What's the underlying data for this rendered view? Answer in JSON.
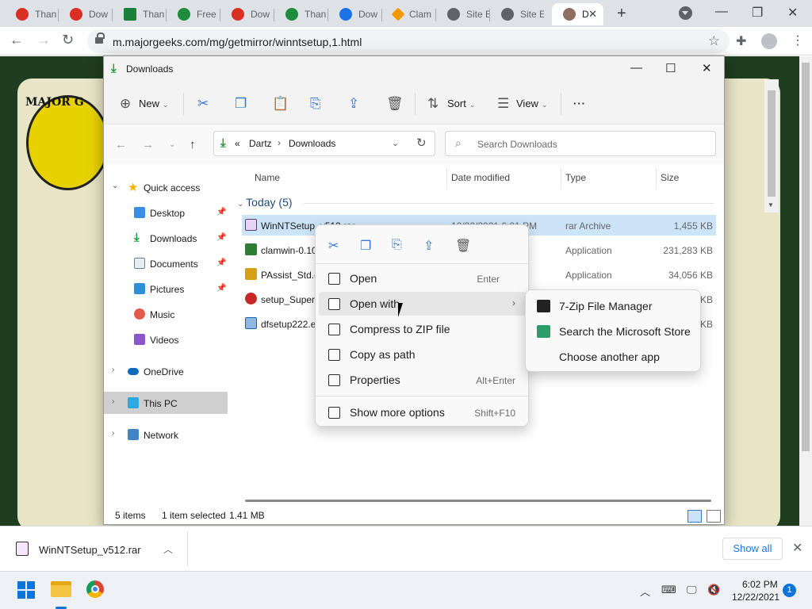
{
  "browser": {
    "tabs": [
      {
        "title": "Than",
        "color": "#d93025"
      },
      {
        "title": "Dow",
        "color": "#d93025"
      },
      {
        "title": "Than",
        "color": "#188038"
      },
      {
        "title": "Free",
        "color": "#1e8e3e"
      },
      {
        "title": "Dow",
        "color": "#d93025"
      },
      {
        "title": "Than",
        "color": "#1e8e3e"
      },
      {
        "title": "Dow",
        "color": "#1a73e8"
      },
      {
        "title": "Clam",
        "color": "#f29900"
      },
      {
        "title": "Site E",
        "color": "#5f6368"
      },
      {
        "title": "Site E",
        "color": "#5f6368"
      },
      {
        "title": "D",
        "color": "#8d6e63"
      }
    ],
    "new_tab": "+",
    "url": "m.majorgeeks.com/mg/getmirror/winntsetup,1.html"
  },
  "website": {
    "logo_text": "MAJOR G"
  },
  "explorer": {
    "title": "Downloads",
    "ribbon": {
      "new_label": "New",
      "sort_label": "Sort",
      "view_label": "View",
      "more": "···"
    },
    "breadcrumb": {
      "overflow": "«",
      "parent": "Dartz",
      "current": "Downloads"
    },
    "search_placeholder": "Search Downloads",
    "nav": {
      "quick_access": "Quick access",
      "desktop": "Desktop",
      "downloads": "Downloads",
      "documents": "Documents",
      "pictures": "Pictures",
      "music": "Music",
      "videos": "Videos",
      "onedrive": "OneDrive",
      "this_pc": "This PC",
      "network": "Network"
    },
    "columns": {
      "name": "Name",
      "date": "Date modified",
      "type": "Type",
      "size": "Size"
    },
    "group": "Today (5)",
    "files": [
      {
        "name": "WinNTSetup_v512.rar",
        "date": "12/22/2021 6:01 PM",
        "type": "rar Archive",
        "size": "1,455 KB",
        "color": "#9b59b6"
      },
      {
        "name": "clamwin-0.10",
        "date": "1",
        "type": "Application",
        "size": "231,283 KB",
        "color": "#2e7d32"
      },
      {
        "name": "PAssist_Std.ex",
        "date": "1",
        "type": "Application",
        "size": "34,056 KB",
        "color": "#d4a017"
      },
      {
        "name": "setup_SuperF",
        "date": "",
        "type": "",
        "size": "KB",
        "color": "#c62828"
      },
      {
        "name": "dfsetup222.ex",
        "date": "",
        "type": "",
        "size": "KB",
        "color": "#1565c0"
      }
    ],
    "status": {
      "count": "5 items",
      "selected": "1 item selected",
      "size": "1.41 MB"
    }
  },
  "context_menu": {
    "items": [
      {
        "label": "Open",
        "shortcut": "Enter"
      },
      {
        "label": "Open with",
        "shortcut": ""
      },
      {
        "label": "Compress to ZIP file",
        "shortcut": ""
      },
      {
        "label": "Copy as path",
        "shortcut": ""
      },
      {
        "label": "Properties",
        "shortcut": "Alt+Enter"
      },
      {
        "label": "Show more options",
        "shortcut": "Shift+F10"
      }
    ]
  },
  "submenu": {
    "items": [
      {
        "label": "7-Zip File Manager",
        "color": "#222"
      },
      {
        "label": "Search the Microsoft Store",
        "color": "#2e9b6a"
      },
      {
        "label": "Choose another app",
        "color": ""
      }
    ]
  },
  "download_shelf": {
    "file_name": "WinNTSetup_v512.rar",
    "show_all": "Show all"
  },
  "taskbar": {
    "time": "6:02 PM",
    "date": "12/22/2021",
    "notifications": "1"
  }
}
